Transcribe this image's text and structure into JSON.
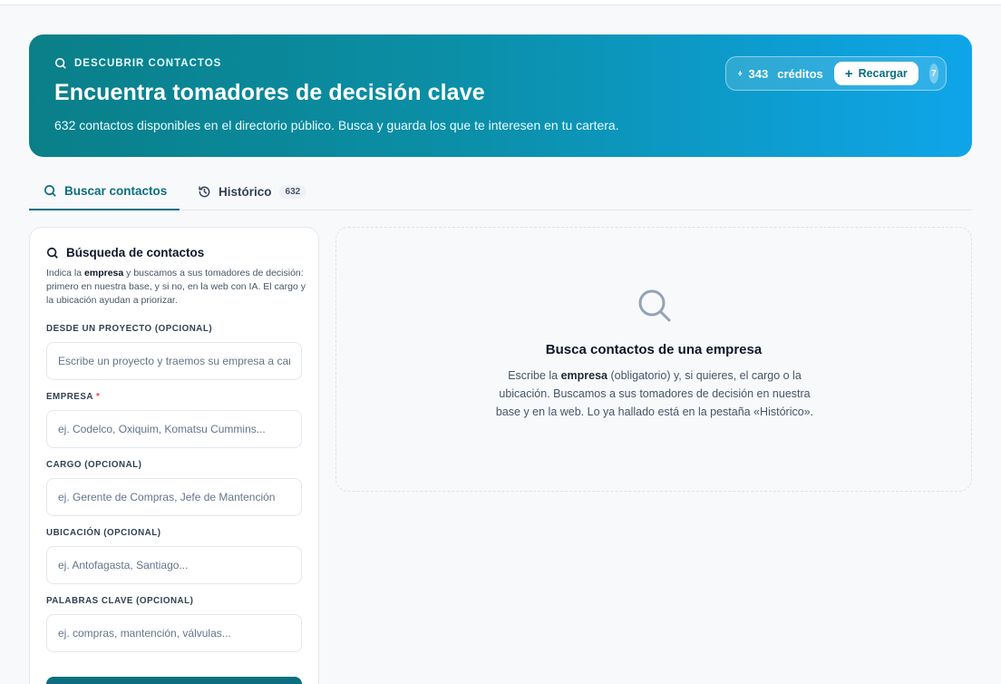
{
  "hero": {
    "eyebrow": "DESCUBRIR CONTACTOS",
    "title": "Encuentra tomadores de decisión clave",
    "subtitle": "632 contactos disponibles en el directorio público. Busca y guarda los que te interesen en tu cartera.",
    "credits_count": "343",
    "credits_label": "créditos",
    "recharge_label": "Recargar",
    "badge": "7"
  },
  "tabs": [
    {
      "label": "Buscar contactos",
      "icon": "search-icon",
      "active": true
    },
    {
      "label": "Histórico",
      "icon": "history-icon",
      "count": "632",
      "active": false
    }
  ],
  "form": {
    "title": "Búsqueda de contactos",
    "desc_pre": "Indica la ",
    "desc_bold": "empresa",
    "desc_post": " y buscamos a sus tomadores de decisión: primero en nuestra base, y si no, en la web con IA. El cargo y la ubicación ayudan a priorizar.",
    "fields": [
      {
        "label": "DESDE UN PROYECTO (OPCIONAL)",
        "placeholder": "Escribe un proyecto y traemos su empresa a cargo",
        "value": ""
      },
      {
        "label": "EMPRESA",
        "required": "*",
        "placeholder": "ej. Codelco, Oxiquim, Komatsu Cummins...",
        "value": ""
      },
      {
        "label": "CARGO (OPCIONAL)",
        "placeholder": "ej. Gerente de Compras, Jefe de Mantención",
        "value": ""
      },
      {
        "label": "UBICACIÓN (OPCIONAL)",
        "placeholder": "ej. Antofagasta, Santiago...",
        "value": ""
      },
      {
        "label": "PALABRAS CLAVE (OPCIONAL)",
        "placeholder": "ej. compras, mantención, válvulas...",
        "value": ""
      }
    ]
  },
  "empty_state": {
    "icon": "search-icon",
    "title": "Busca contactos de una empresa",
    "text_pre": "Escribe la ",
    "text_bold": "empresa",
    "text_post": " (obligatorio) y, si quieres, el cargo o la ubicación. Buscamos a sus tomadores de decisión en nuestra base y en la web. Lo ya hallado está en la pestaña «Histórico»."
  },
  "colors": {
    "accent": "#0b6f7f",
    "hero_start": "#0a7f88",
    "hero_end": "#0ea5e9",
    "required": "#ef4444"
  }
}
